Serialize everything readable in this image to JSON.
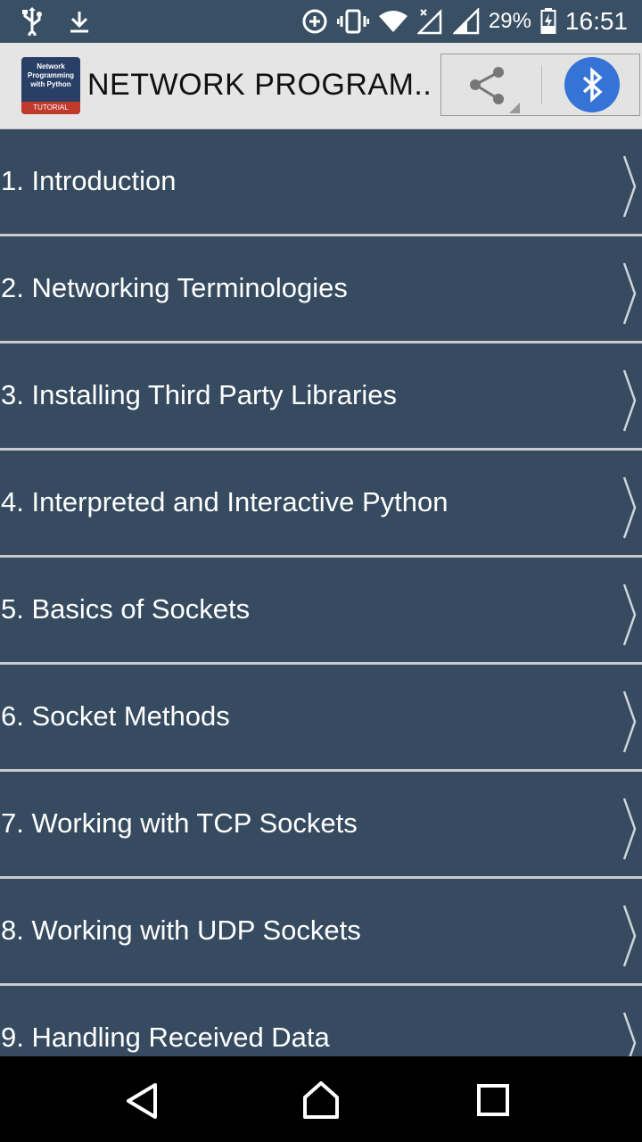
{
  "status_bar": {
    "icons_left": [
      "usb-icon",
      "download-icon"
    ],
    "icons_right": [
      "data-saver-icon",
      "vibrate-icon",
      "wifi-icon",
      "signal-no-data-icon",
      "signal-icon"
    ],
    "battery": "29%",
    "time": "16:51"
  },
  "app_bar": {
    "logo": {
      "lines": [
        "Network",
        "Programming",
        "with Python"
      ],
      "tag": "TUTORIAL"
    },
    "title": "NETWORK PROGRAM..",
    "share_icon": "share-icon",
    "bluetooth_icon": "bluetooth-icon",
    "colors": {
      "bluetooth_bg": "#3573d6",
      "bar_bg": "#e5e5e5"
    }
  },
  "list": {
    "items": [
      "1. Introduction",
      "2. Networking Terminologies",
      "3. Installing Third Party Libraries",
      "4. Interpreted and Interactive Python",
      "5. Basics of Sockets",
      "6. Socket Methods",
      "7. Working with TCP Sockets",
      "8. Working with UDP Sockets",
      "9. Handling Received Data"
    ],
    "colors": {
      "item_bg": "#364b60",
      "separator": "#c8ccd0",
      "text": "#ffffff"
    }
  },
  "nav_bar": {
    "buttons": [
      "back-icon",
      "home-icon",
      "recents-icon"
    ]
  }
}
